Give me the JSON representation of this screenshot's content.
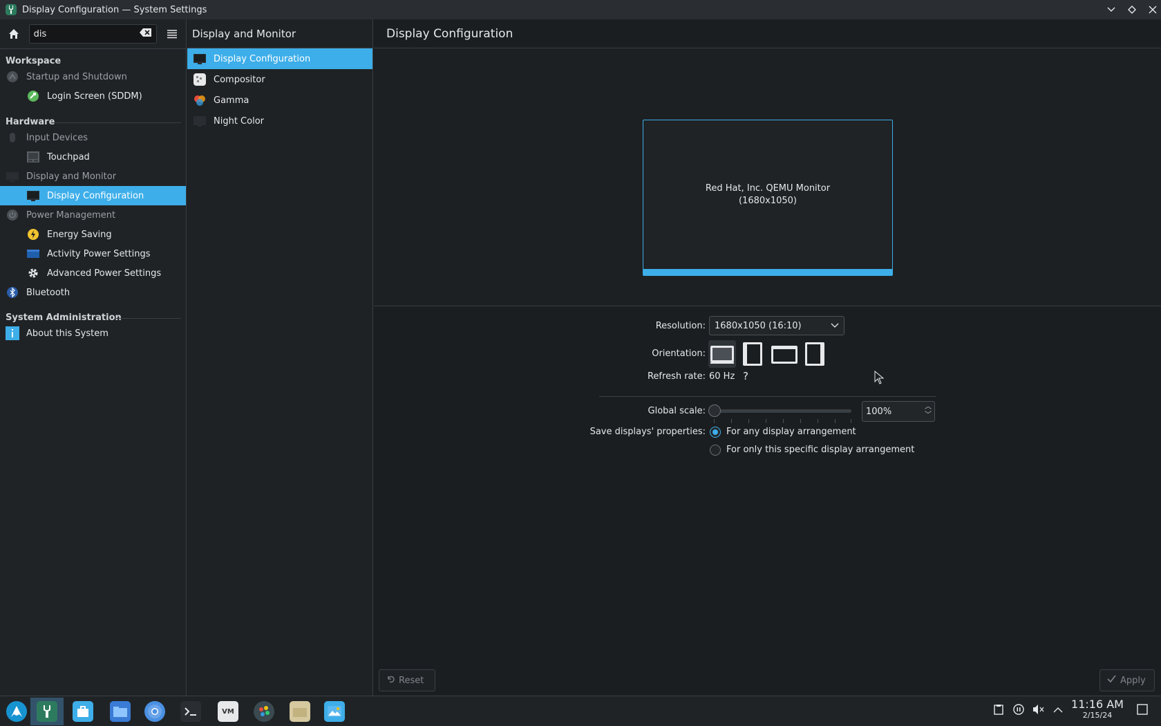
{
  "window": {
    "title": "Display Configuration — System Settings"
  },
  "search": {
    "value": "dis"
  },
  "sidebar": {
    "categories": [
      {
        "label": "Workspace"
      },
      {
        "label": "Hardware"
      },
      {
        "label": "System Administration"
      }
    ],
    "items": [
      {
        "label": "Startup and Shutdown"
      },
      {
        "label": "Login Screen (SDDM)"
      },
      {
        "label": "Input Devices"
      },
      {
        "label": "Touchpad"
      },
      {
        "label": "Display and Monitor"
      },
      {
        "label": "Display Configuration"
      },
      {
        "label": "Power Management"
      },
      {
        "label": "Energy Saving"
      },
      {
        "label": "Activity Power Settings"
      },
      {
        "label": "Advanced Power Settings"
      },
      {
        "label": "Bluetooth"
      },
      {
        "label": "About this System"
      }
    ]
  },
  "subpanel": {
    "title": "Display and Monitor",
    "items": [
      {
        "label": "Display Configuration"
      },
      {
        "label": "Compositor"
      },
      {
        "label": "Gamma"
      },
      {
        "label": "Night Color"
      }
    ]
  },
  "main": {
    "title": "Display Configuration",
    "monitor": {
      "name": "Red Hat, Inc. QEMU Monitor",
      "resolution": "(1680x1050)"
    },
    "resolution_label": "Resolution:",
    "resolution_value": "1680x1050 (16:10)",
    "orientation_label": "Orientation:",
    "refresh_label": "Refresh rate:",
    "refresh_value": "60 Hz",
    "refresh_help": "?",
    "scale_label": "Global scale:",
    "scale_value": "100%",
    "save_label": "Save displays' properties:",
    "save_options": [
      {
        "label": "For any display arrangement",
        "selected": true
      },
      {
        "label": "For only this specific display arrangement",
        "selected": false
      }
    ],
    "reset_label": "Reset",
    "apply_label": "Apply"
  },
  "taskbar": {
    "time": "11:16 AM",
    "date": "2/15/24"
  },
  "colors": {
    "accent": "#3daee9",
    "background": "#1b1e20"
  }
}
